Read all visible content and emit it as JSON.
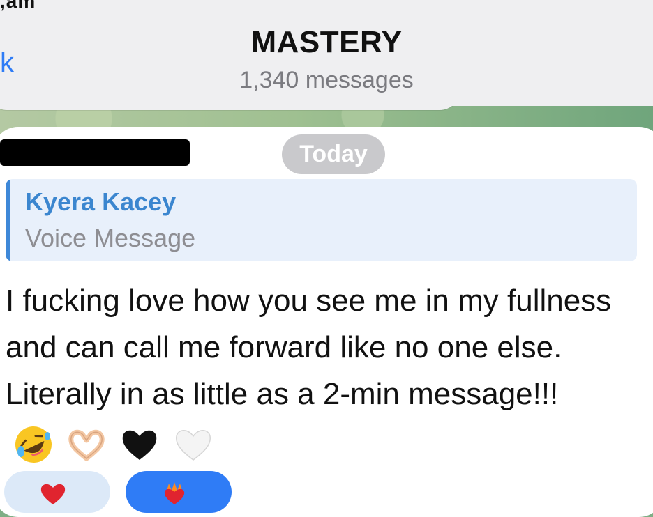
{
  "status_bar": {
    "fragment": ",am"
  },
  "header": {
    "back_label": "k",
    "title": "MASTERY",
    "subtitle": "1,340 messages"
  },
  "date_divider": "Today",
  "message": {
    "reply": {
      "name": "Kyera Kacey",
      "snippet": "Voice Message"
    },
    "text": "I fucking love how you see me in my fullness and can call me forward like no one else. Literally in as little as a 2-min message!!!",
    "emojis": [
      "rolling-on-floor-laughing",
      "heart-hands",
      "black-heart",
      "white-heart"
    ]
  },
  "reactions": [
    {
      "icon": "red-heart-icon"
    },
    {
      "icon": "heart-on-fire-icon"
    }
  ],
  "colors": {
    "accent_blue": "#2f7cf6",
    "reply_name": "#3b86cf",
    "reply_bg": "#e8f0fb",
    "date_pill": "#c9c9cc"
  }
}
